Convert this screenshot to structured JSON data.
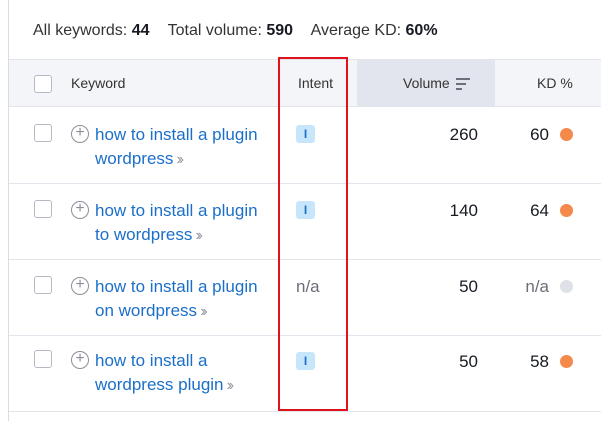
{
  "summary": {
    "all_keywords_label": "All keywords:",
    "all_keywords_value": "44",
    "total_volume_label": "Total volume:",
    "total_volume_value": "590",
    "average_kd_label": "Average KD:",
    "average_kd_value": "60%"
  },
  "table": {
    "headers": {
      "keyword": "Keyword",
      "intent": "Intent",
      "volume": "Volume",
      "kd": "KD %"
    },
    "rows": [
      {
        "keyword_line1": "how to install a plugin",
        "keyword_line2": "wordpress",
        "intent": "I",
        "volume": "260",
        "kd": "60",
        "kd_color": "#f5894b"
      },
      {
        "keyword_line1": "how to install a plugin",
        "keyword_line2": "to wordpress",
        "intent": "I",
        "volume": "140",
        "kd": "64",
        "kd_color": "#f5894b"
      },
      {
        "keyword_line1": "how to install a plugin",
        "keyword_line2": "on wordpress",
        "intent": "n/a",
        "volume": "50",
        "kd": "n/a",
        "kd_color": "#dfe1e8"
      },
      {
        "keyword_line1": "how to install a",
        "keyword_line2": "wordpress plugin",
        "intent": "I",
        "volume": "50",
        "kd": "58",
        "kd_color": "#f5894b"
      }
    ]
  },
  "icons": {
    "add": "plus-circle-icon",
    "chevron": "double-chevron-right-icon",
    "sort": "sort-descending-icon"
  },
  "colors": {
    "link": "#1b6fc9",
    "intent_badge_bg": "#c7e6fb",
    "kd_orange": "#f5894b",
    "kd_na": "#dfe1e8",
    "highlight": "#e0131d"
  }
}
